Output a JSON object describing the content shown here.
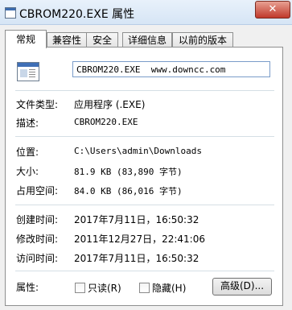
{
  "window": {
    "title": "CBROM220.EXE 属性",
    "close_glyph": "✕"
  },
  "tabs": [
    {
      "label": "常规",
      "active": true
    },
    {
      "label": "兼容性",
      "active": false
    },
    {
      "label": "安全",
      "active": false
    },
    {
      "label": "详细信息",
      "active": false
    },
    {
      "label": "以前的版本",
      "active": false
    }
  ],
  "general": {
    "filename": "CBROM220.EXE  www.downcc.com",
    "file_type_label": "文件类型:",
    "file_type_value": "应用程序 (.EXE)",
    "description_label": "描述:",
    "description_value": "CBROM220.EXE",
    "location_label": "位置:",
    "location_value": "C:\\Users\\admin\\Downloads",
    "size_label": "大小:",
    "size_value": "81.9 KB (83,890 字节)",
    "size_on_disk_label": "占用空间:",
    "size_on_disk_value": "84.0 KB (86,016 字节)",
    "created_label": "创建时间:",
    "created_value": "2017年7月11日，16:50:32",
    "modified_label": "修改时间:",
    "modified_value": "2011年12月27日，22:41:06",
    "accessed_label": "访问时间:",
    "accessed_value": "2017年7月11日，16:50:32",
    "attributes_label": "属性:",
    "readonly_label": "只读(R)",
    "readonly_checked": false,
    "hidden_label": "隐藏(H)",
    "hidden_checked": false,
    "advanced_label": "高级(D)..."
  }
}
